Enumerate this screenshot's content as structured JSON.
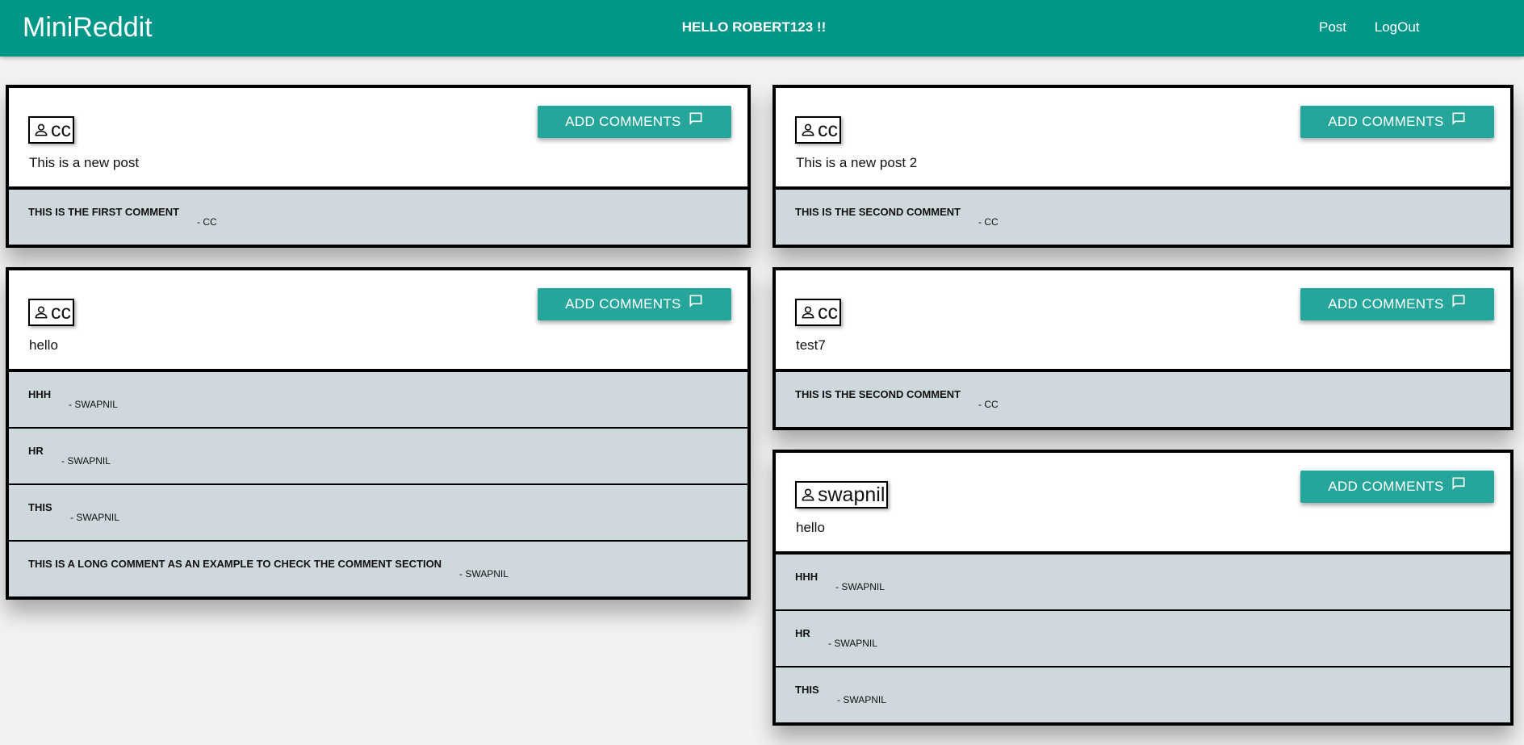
{
  "navbar": {
    "brand": "MiniReddit",
    "greeting": "HELLO ROBERT123 !!",
    "links": [
      "Post",
      "LogOut"
    ],
    "color": "#009688"
  },
  "add_button_label": "ADD COMMENTS",
  "icons": {
    "author": "person-icon",
    "comment": "comment-bubble-icon"
  },
  "posts": [
    {
      "author": "cc",
      "text": "This is a new post",
      "comments": [
        {
          "text": "This is the first comment",
          "author": "- cc"
        }
      ]
    },
    {
      "author": "cc",
      "text": "hello",
      "comments": [
        {
          "text": "hhh",
          "author": "- swapnil"
        },
        {
          "text": "hr",
          "author": "- swapnil"
        },
        {
          "text": "this",
          "author": "- swapnil"
        },
        {
          "text": "this is a long comment as an example to check the comment section",
          "author": "- swapnil"
        }
      ]
    },
    {
      "author": "cc",
      "text": "This is a new post 2",
      "comments": [
        {
          "text": "This is the second comment",
          "author": "- cc"
        }
      ]
    },
    {
      "author": "cc",
      "text": "test7",
      "comments": [
        {
          "text": "This is the second comment",
          "author": "- cc"
        }
      ]
    },
    {
      "author": "swapnil",
      "text": "hello",
      "comments": [
        {
          "text": "hhh",
          "author": "- swapnil"
        },
        {
          "text": "hr",
          "author": "- swapnil"
        },
        {
          "text": "this",
          "author": "- swapnil"
        }
      ]
    }
  ]
}
